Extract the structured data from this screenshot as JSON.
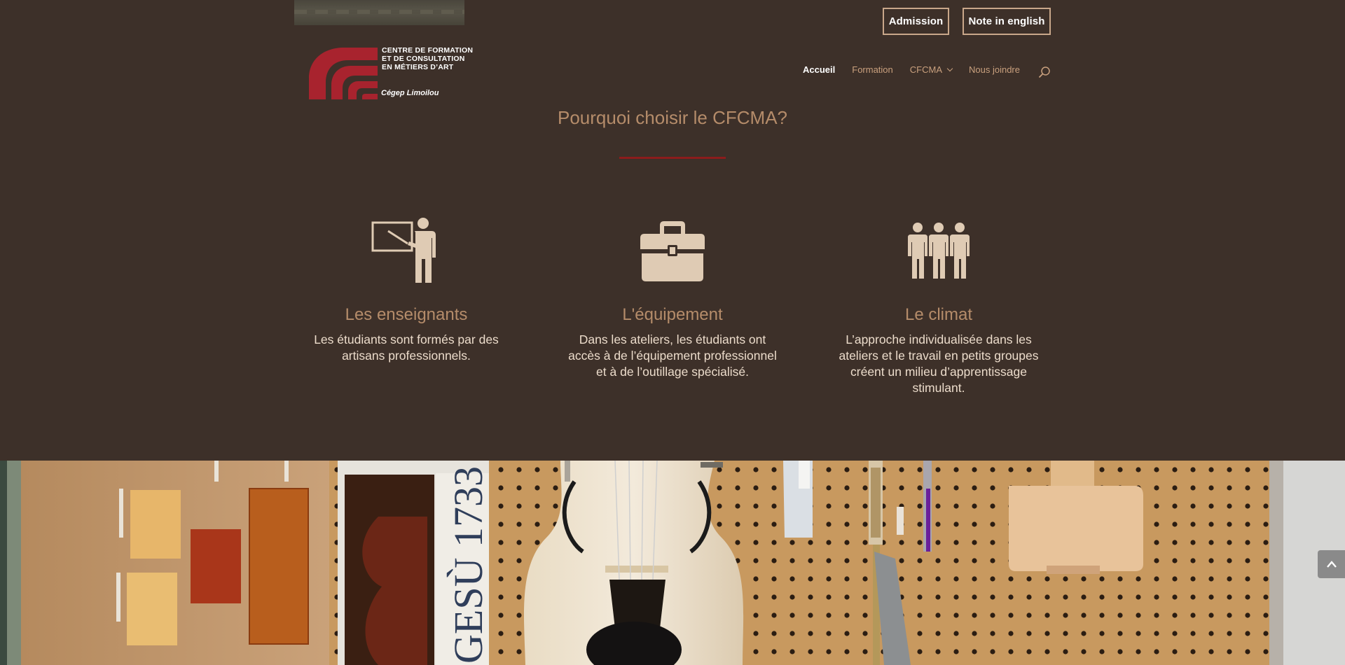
{
  "top_buttons": {
    "admission": "Admission",
    "english": "Note in english"
  },
  "logo": {
    "lines": [
      "CENTRE DE FORMATION",
      "ET DE CONSULTATION",
      "EN MÉTIERS D’ART"
    ],
    "sub": "Cégep Limoilou"
  },
  "nav": {
    "items": [
      {
        "label": "Accueil"
      },
      {
        "label": "Formation"
      },
      {
        "label": "CFCMA"
      },
      {
        "label": "Nous joindre"
      }
    ]
  },
  "section": {
    "title": "Pourquoi choisir le CFCMA?",
    "columns": [
      {
        "icon": "teacher-icon",
        "heading": "Les enseignants",
        "text": "Les étudiants sont formés par des artisans professionnels."
      },
      {
        "icon": "toolbox-icon",
        "heading": "L'équipement",
        "text": "Dans les ateliers, les étudiants ont accès à de l’équipement professionnel et à de l’outillage spécialisé."
      },
      {
        "icon": "group-icon",
        "heading": "Le climat",
        "text": "L’approche individualisée dans les ateliers et le travail en petits groupes créent un milieu d’apprentissage stimulant."
      }
    ]
  },
  "photo": {
    "sign_text": "GESÙ 1733"
  },
  "colors": {
    "background": "#3d3029",
    "accent_text": "#b58c6a",
    "rule": "#8c1c1c",
    "logo_red": "#a8232e",
    "icon_fill": "#dfcbb4",
    "pegboard": "#c89a64"
  }
}
